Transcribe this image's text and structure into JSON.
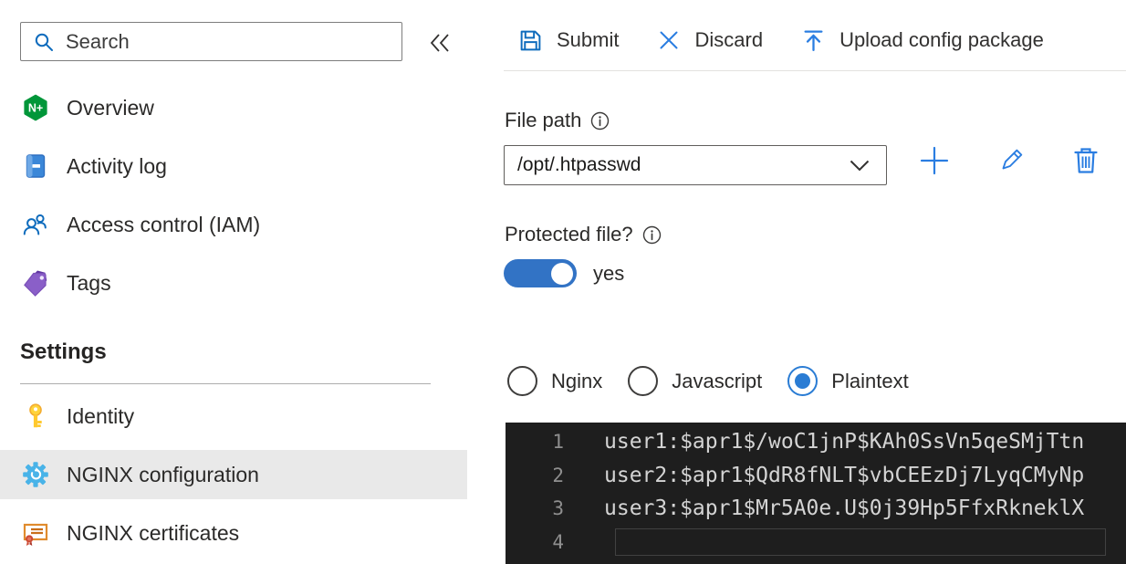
{
  "sidebar": {
    "search": {
      "placeholder": "Search"
    },
    "items": [
      {
        "label": "Overview",
        "icon": "nginx-logo-icon"
      },
      {
        "label": "Activity log",
        "icon": "activity-log-icon"
      },
      {
        "label": "Access control (IAM)",
        "icon": "access-control-icon"
      },
      {
        "label": "Tags",
        "icon": "tag-icon"
      }
    ],
    "settings": {
      "header": "Settings",
      "items": [
        {
          "label": "Identity",
          "icon": "key-icon",
          "selected": false
        },
        {
          "label": "NGINX configuration",
          "icon": "gear-icon",
          "selected": true
        },
        {
          "label": "NGINX certificates",
          "icon": "certificate-icon",
          "selected": false
        }
      ]
    }
  },
  "toolbar": {
    "submit_label": "Submit",
    "discard_label": "Discard",
    "upload_label": "Upload config package"
  },
  "file_path": {
    "label": "File path",
    "value": "/opt/.htpasswd"
  },
  "protected_file": {
    "label": "Protected file?",
    "state_label": "yes",
    "enabled": true
  },
  "syntax_options": [
    {
      "label": "Nginx",
      "selected": false
    },
    {
      "label": "Javascript",
      "selected": false
    },
    {
      "label": "Plaintext",
      "selected": true
    }
  ],
  "editor": {
    "lines": [
      {
        "number": "1",
        "text": "user1:$apr1$/woC1jnP$KAh0SsVn5qeSMjTtn"
      },
      {
        "number": "2",
        "text": "user2:$apr1$QdR8fNLT$vbCEEzDj7LyqCMyNp"
      },
      {
        "number": "3",
        "text": "user3:$apr1$Mr5A0e.U$0j39Hp5FfxRkneklX"
      },
      {
        "number": "4",
        "text": ""
      }
    ]
  },
  "colors": {
    "accent_blue": "#0f6cbd",
    "toggle_on": "#3273c5",
    "radio_selected": "#2a7cd4",
    "selected_item_bg": "#e9e9e9",
    "editor_bg": "#1e1e1e",
    "editor_text": "#d4d4d4",
    "nginx_green": "#009639"
  }
}
